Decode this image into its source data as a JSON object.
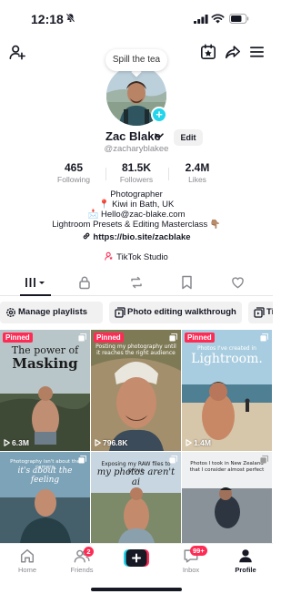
{
  "status_bar": {
    "time": "12:18"
  },
  "profile": {
    "tooltip": "Spill the tea",
    "name": "Zac Blake",
    "edit_label": "Edit",
    "handle": "@zacharyblakee",
    "stats": [
      {
        "value": "465",
        "label": "Following"
      },
      {
        "value": "81.5K",
        "label": "Followers"
      },
      {
        "value": "2.4M",
        "label": "Likes"
      }
    ],
    "bio_lines": [
      "Photographer",
      "📍 Kiwi in Bath, UK",
      "📩 Hello@zac-blake.com",
      "Lightroom Presets & Editing Masterclass 👇🏽"
    ],
    "link": "https://bio.site/zacblake",
    "studio_label": "TikTok Studio"
  },
  "playlists": [
    {
      "label": "Manage playlists",
      "icon": "gear-icon"
    },
    {
      "label": "Photo editing walkthrough",
      "icon": "playlist-icon"
    },
    {
      "label": "Ti",
      "icon": "playlist-icon"
    }
  ],
  "videos": [
    {
      "pinned": "Pinned",
      "caption": "The power of",
      "caption2": "Masking",
      "views": "6.3M"
    },
    {
      "pinned": "Pinned",
      "caption": "Posting my photography until it reaches the right audience",
      "views": "796.8K"
    },
    {
      "pinned": "Pinned",
      "caption": "Photos I've created in",
      "caption2": "Lightroom.",
      "views": "1.4M"
    },
    {
      "caption": "Photography isn't about the camera",
      "caption2": "it's about the feeling"
    },
    {
      "caption": "Exposing my RAW files to prove",
      "caption2": "my photos aren't ai"
    },
    {
      "caption": "Photos I took in New Zealand that I consider almost perfect"
    }
  ],
  "bottom_nav": {
    "home": "Home",
    "friends": "Friends",
    "friends_badge": "2",
    "inbox": "Inbox",
    "inbox_badge": "99+",
    "profile": "Profile"
  },
  "colors": {
    "accent_red": "#fe2c55",
    "accent_cyan": "#20d5ec",
    "text": "#161823",
    "muted": "#8a8b91"
  }
}
